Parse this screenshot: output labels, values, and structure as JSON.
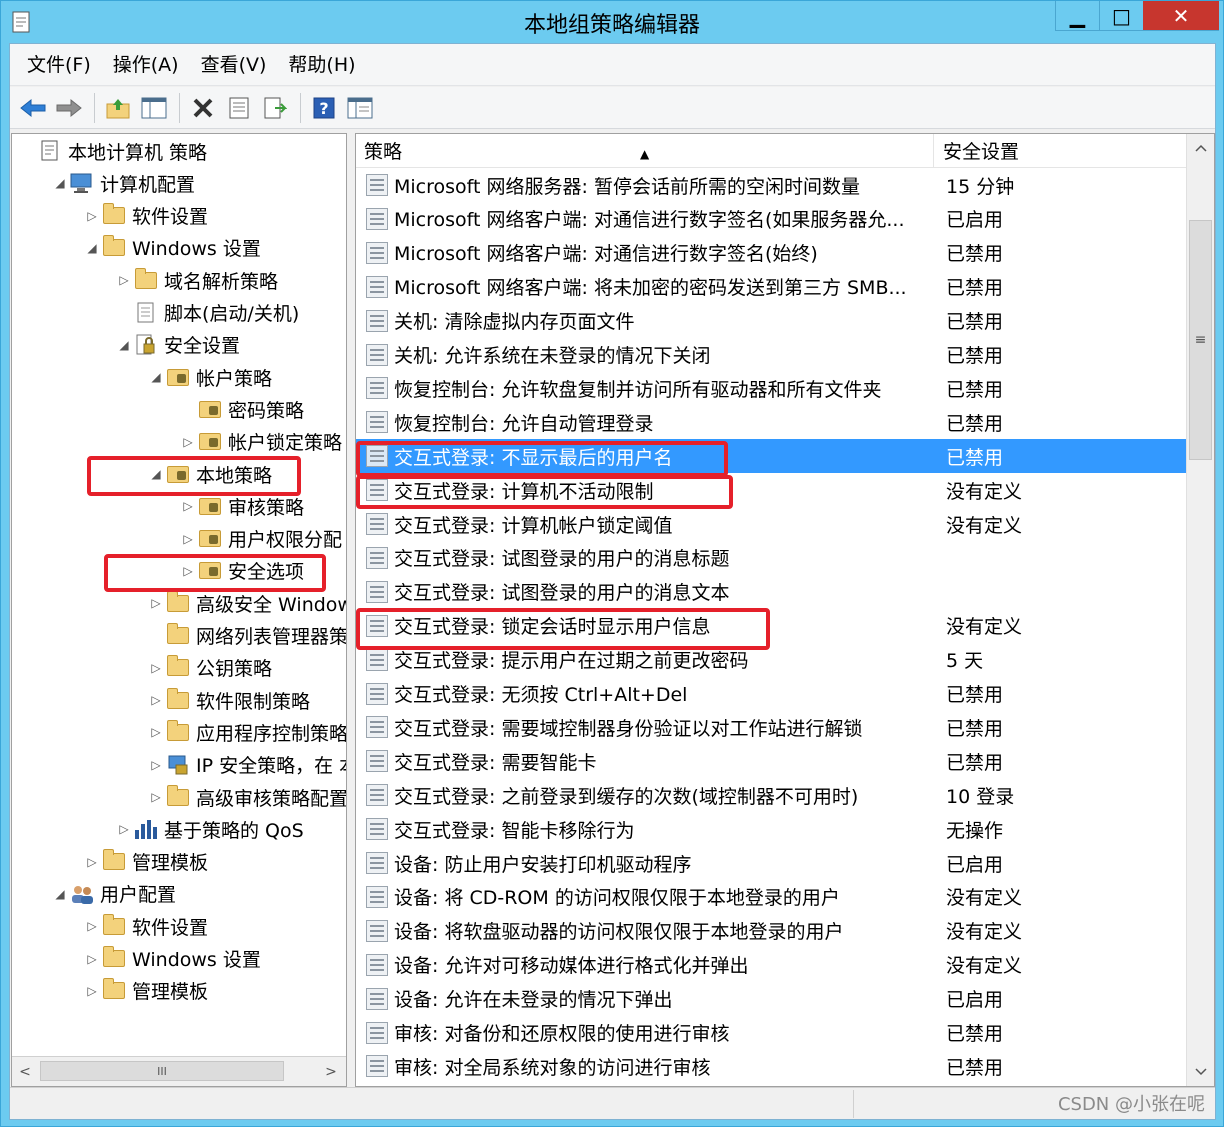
{
  "window": {
    "title": "本地组策略编辑器",
    "minimize_glyph": "▁",
    "maximize_glyph": "□",
    "close_glyph": "✕"
  },
  "menu": [
    "文件(F)",
    "操作(A)",
    "查看(V)",
    "帮助(H)"
  ],
  "toolbar": {
    "icons": [
      "back-icon",
      "forward-icon",
      "up-folder-icon",
      "show-hide-tree-icon",
      "delete-icon",
      "properties-icon",
      "export-list-icon",
      "help-icon",
      "filter-view-icon"
    ]
  },
  "tree": [
    {
      "label": "本地计算机 策略",
      "twisty": "",
      "icon": "policy-doc-icon"
    },
    {
      "label": "计算机配置",
      "twisty": "◢",
      "icon": "computer-icon"
    },
    {
      "label": "软件设置",
      "twisty": "▷",
      "icon": "folder-icon"
    },
    {
      "label": "Windows 设置",
      "twisty": "◢",
      "icon": "folder-icon"
    },
    {
      "label": "域名解析策略",
      "twisty": "▷",
      "icon": "folder-icon"
    },
    {
      "label": "脚本(启动/关机)",
      "twisty": "",
      "icon": "script-icon"
    },
    {
      "label": "安全设置",
      "twisty": "◢",
      "icon": "security-icon"
    },
    {
      "label": "帐户策略",
      "twisty": "◢",
      "icon": "lock-folder-icon"
    },
    {
      "label": "密码策略",
      "twisty": "",
      "icon": "lock-folder-icon"
    },
    {
      "label": "帐户锁定策略",
      "twisty": "▷",
      "icon": "lock-folder-icon"
    },
    {
      "label": "本地策略",
      "twisty": "◢",
      "icon": "lock-folder-icon"
    },
    {
      "label": "审核策略",
      "twisty": "▷",
      "icon": "lock-folder-icon"
    },
    {
      "label": "用户权限分配",
      "twisty": "▷",
      "icon": "lock-folder-icon"
    },
    {
      "label": "安全选项",
      "twisty": "▷",
      "icon": "lock-folder-icon"
    },
    {
      "label": "高级安全 Window:",
      "twisty": "▷",
      "icon": "folder-icon"
    },
    {
      "label": "网络列表管理器策略",
      "twisty": "",
      "icon": "folder-icon"
    },
    {
      "label": "公钥策略",
      "twisty": "▷",
      "icon": "folder-icon"
    },
    {
      "label": "软件限制策略",
      "twisty": "▷",
      "icon": "folder-icon"
    },
    {
      "label": "应用程序控制策略",
      "twisty": "▷",
      "icon": "folder-icon"
    },
    {
      "label": "IP 安全策略，在 本",
      "twisty": "▷",
      "icon": "ip-security-icon"
    },
    {
      "label": "高级审核策略配置",
      "twisty": "▷",
      "icon": "folder-icon"
    },
    {
      "label": "基于策略的 QoS",
      "twisty": "▷",
      "icon": "qos-chart-icon"
    },
    {
      "label": "管理模板",
      "twisty": "▷",
      "icon": "folder-icon"
    },
    {
      "label": "用户配置",
      "twisty": "◢",
      "icon": "users-icon"
    },
    {
      "label": "软件设置",
      "twisty": "▷",
      "icon": "folder-icon"
    },
    {
      "label": "Windows 设置",
      "twisty": "▷",
      "icon": "folder-icon"
    },
    {
      "label": "管理模板",
      "twisty": "▷",
      "icon": "folder-icon"
    }
  ],
  "list": {
    "col_policy": "策略",
    "col_setting": "安全设置",
    "rows": [
      {
        "policy": "Microsoft 网络服务器: 暂停会话前所需的空闲时间数量",
        "setting": "15 分钟"
      },
      {
        "policy": "Microsoft 网络客户端: 对通信进行数字签名(如果服务器允...",
        "setting": "已启用"
      },
      {
        "policy": "Microsoft 网络客户端: 对通信进行数字签名(始终)",
        "setting": "已禁用"
      },
      {
        "policy": "Microsoft 网络客户端: 将未加密的密码发送到第三方 SMB...",
        "setting": "已禁用"
      },
      {
        "policy": "关机: 清除虚拟内存页面文件",
        "setting": "已禁用"
      },
      {
        "policy": "关机: 允许系统在未登录的情况下关闭",
        "setting": "已禁用"
      },
      {
        "policy": "恢复控制台: 允许软盘复制并访问所有驱动器和所有文件夹",
        "setting": "已禁用"
      },
      {
        "policy": "恢复控制台: 允许自动管理登录",
        "setting": "已禁用"
      },
      {
        "policy": "交互式登录: 不显示最后的用户名",
        "setting": "已禁用"
      },
      {
        "policy": "交互式登录: 计算机不活动限制",
        "setting": "没有定义"
      },
      {
        "policy": "交互式登录: 计算机帐户锁定阈值",
        "setting": "没有定义"
      },
      {
        "policy": "交互式登录: 试图登录的用户的消息标题",
        "setting": ""
      },
      {
        "policy": "交互式登录: 试图登录的用户的消息文本",
        "setting": ""
      },
      {
        "policy": "交互式登录: 锁定会话时显示用户信息",
        "setting": "没有定义"
      },
      {
        "policy": "交互式登录: 提示用户在过期之前更改密码",
        "setting": "5 天"
      },
      {
        "policy": "交互式登录: 无须按 Ctrl+Alt+Del",
        "setting": "已禁用"
      },
      {
        "policy": "交互式登录: 需要域控制器身份验证以对工作站进行解锁",
        "setting": "已禁用"
      },
      {
        "policy": "交互式登录: 需要智能卡",
        "setting": "已禁用"
      },
      {
        "policy": "交互式登录: 之前登录到缓存的次数(域控制器不可用时)",
        "setting": "10 登录"
      },
      {
        "policy": "交互式登录: 智能卡移除行为",
        "setting": "无操作"
      },
      {
        "policy": "设备: 防止用户安装打印机驱动程序",
        "setting": "已启用"
      },
      {
        "policy": "设备: 将 CD-ROM 的访问权限仅限于本地登录的用户",
        "setting": "没有定义"
      },
      {
        "policy": "设备: 将软盘驱动器的访问权限仅限于本地登录的用户",
        "setting": "没有定义"
      },
      {
        "policy": "设备: 允许对可移动媒体进行格式化并弹出",
        "setting": "没有定义"
      },
      {
        "policy": "设备: 允许在未登录的情况下弹出",
        "setting": "已启用"
      },
      {
        "policy": "审核: 对备份和还原权限的使用进行审核",
        "setting": "已禁用"
      },
      {
        "policy": "审核: 对全局系统对象的访问进行审核",
        "setting": "已禁用"
      }
    ]
  },
  "selected_row_index": 8,
  "scroll_glyphs": {
    "left": "<",
    "right": ">",
    "up": "^",
    "down": "v",
    "grip_h": "III",
    "grip_v": "≡"
  },
  "watermark": "CSDN @小张在呢",
  "colors": {
    "selection": "#3399ff",
    "highlight_box": "#e5202a",
    "titlebar": "#6ccbf0",
    "close": "#c7362e"
  }
}
